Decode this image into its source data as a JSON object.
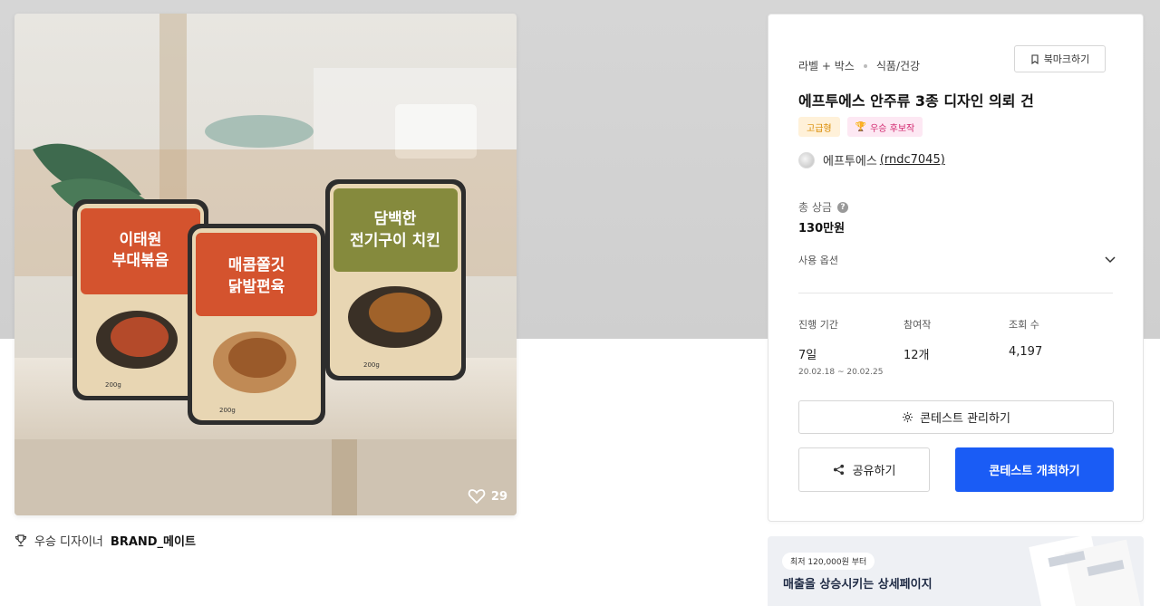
{
  "hero": {
    "like_count": "29",
    "packages": [
      {
        "line1": "이태원",
        "line2": "부대볶음",
        "weight": "200g"
      },
      {
        "line1": "매콤쫄깃",
        "line2": "닭발편육",
        "weight": "200g"
      },
      {
        "line1": "담백한",
        "line2": "전기구이 치킨",
        "weight": "200g"
      }
    ]
  },
  "winner": {
    "prefix": "우승 디자이너",
    "name": "BRAND_메이트"
  },
  "panel": {
    "category": "라벨 + 박스",
    "subcategory": "식품/건강",
    "bookmark_label": "북마크하기",
    "title": "에프투에스 안주류 3종 디자인 의뢰 건",
    "tag_premium": "고급형",
    "tag_candidate": "우승 후보작",
    "author_name": "에프투에스",
    "author_id": "(rndc7045)",
    "prize_label": "총 상금",
    "prize_value": "130만원",
    "options_label": "사용 옵션",
    "stats": {
      "duration_label": "진행 기간",
      "duration_value": "7일",
      "duration_range": "20.02.18 ~ 20.02.25",
      "participants_label": "참여작",
      "participants_value": "12개",
      "views_label": "조회 수",
      "views_value": "4,197"
    },
    "manage_label": "콘테스트 관리하기",
    "share_label": "공유하기",
    "open_label": "콘테스트 개최하기"
  },
  "ad": {
    "badge": "최저 120,000원 부터",
    "text": "매출을 상승시키는 상세페이지"
  },
  "colors": {
    "primary": "#1a5cf5",
    "premium": "#d98a00",
    "candidate": "#d1266e"
  }
}
